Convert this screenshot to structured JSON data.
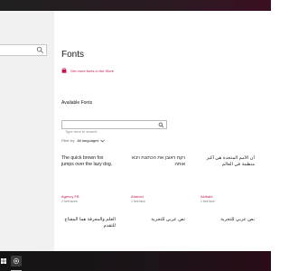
{
  "colors": {
    "accent": "#c3174a",
    "titlebar": "#1f1f1f",
    "taskbar": "#141414",
    "sidebar": "#f1f1f1"
  },
  "page": {
    "title": "Fonts",
    "store_link": "Get more fonts in the Store",
    "store_icon": "store-bag-icon",
    "section_title": "Available Fonts",
    "search": {
      "placeholder": "Type here to search.",
      "icon": "search-icon"
    },
    "filter": {
      "label": "Filter by:",
      "value": "All languages",
      "icon": "chevron-down-icon"
    }
  },
  "sidebar": {
    "search_icon": "search-icon"
  },
  "fonts": [
    {
      "sample": "The quick brown fox jumps over the lazy dog.",
      "name": "Agency FB",
      "count": "2 font faces",
      "rtl": false
    },
    {
      "sample": "ויקח ראובן את הכתונת ויבא אותה",
      "name": "Aharoni",
      "count": "1 font face",
      "rtl": true
    },
    {
      "sample": "أن الأمم المتحدة هي أكبر منظمة في العالم",
      "name": "Aldhabi",
      "count": "1 font face",
      "rtl": true
    },
    {
      "sample": "",
      "name": "",
      "count": "",
      "rtl": false
    },
    {
      "sample": "العلم والمعرفة هما المفتاح للتقدم",
      "name": "",
      "count": "",
      "rtl": true
    },
    {
      "sample": "نص عربي للتجربة",
      "name": "",
      "count": "",
      "rtl": true
    },
    {
      "sample": "نص عربي للتجربة",
      "name": "",
      "count": "",
      "rtl": true
    },
    {
      "sample": "",
      "name": "",
      "count": "",
      "rtl": false
    }
  ],
  "taskbar": {
    "start_icon": "windows-icon",
    "app_icon": "settings-gear-icon"
  }
}
